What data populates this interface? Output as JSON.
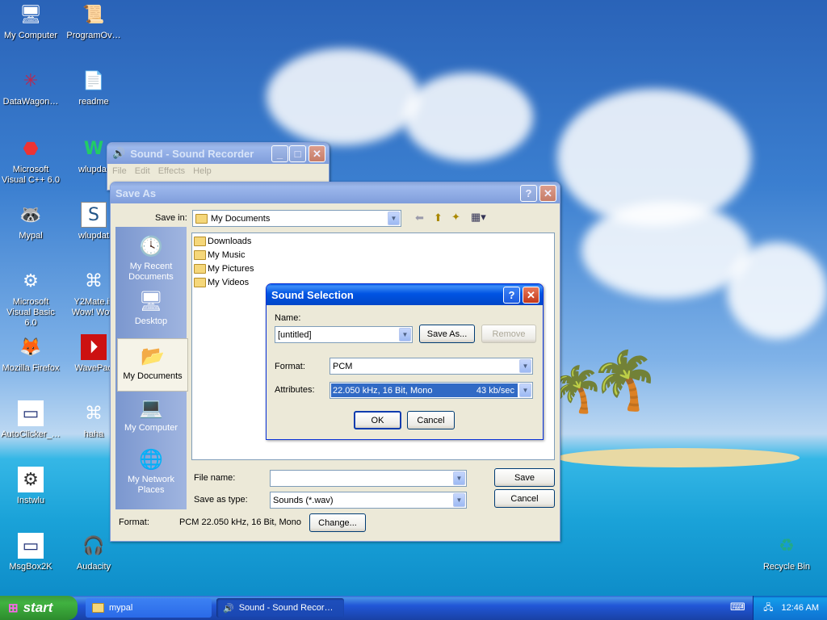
{
  "desktop": {
    "icons": [
      {
        "label": "My Computer",
        "glyph": "🖥"
      },
      {
        "label": "ProgramOv…",
        "glyph": "📜"
      },
      {
        "label": "DataWagon…",
        "glyph": "✳"
      },
      {
        "label": "readme",
        "glyph": "📄"
      },
      {
        "label": "Microsoft Visual C++ 6.0",
        "glyph": "⬣"
      },
      {
        "label": "wlupdat",
        "glyph": "W"
      },
      {
        "label": "Mypal",
        "glyph": "🦝"
      },
      {
        "label": "wlupdat",
        "glyph": "S"
      },
      {
        "label": "Microsoft Visual Basic 6.0",
        "glyph": "⚙"
      },
      {
        "label": "Y2Mate.is Wow! Wow",
        "glyph": "⌘"
      },
      {
        "label": "Mozilla Firefox",
        "glyph": "🦊"
      },
      {
        "label": "WavePad",
        "glyph": "⏵"
      },
      {
        "label": "AutoClicker_…",
        "glyph": "▭"
      },
      {
        "label": "haha",
        "glyph": "⌘"
      },
      {
        "label": "Instwlu",
        "glyph": "⚙"
      },
      {
        "label": "MsgBox2K",
        "glyph": "▭"
      },
      {
        "label": "Audacity",
        "glyph": "🎧"
      },
      {
        "label": "Recycle Bin",
        "glyph": "♻"
      }
    ]
  },
  "recorder": {
    "title": "Sound - Sound Recorder",
    "menu": [
      "File",
      "Edit",
      "Effects",
      "Help"
    ]
  },
  "save_as": {
    "title": "Save As",
    "save_in_label": "Save in:",
    "save_in_value": "My Documents",
    "places": [
      {
        "label": "My Recent Documents",
        "glyph": "🕓"
      },
      {
        "label": "Desktop",
        "glyph": "🖥"
      },
      {
        "label": "My Documents",
        "glyph": "📂"
      },
      {
        "label": "My Computer",
        "glyph": "💻"
      },
      {
        "label": "My Network Places",
        "glyph": "🌐"
      }
    ],
    "files": [
      "Downloads",
      "My Music",
      "My Pictures",
      "My Videos"
    ],
    "file_name_label": "File name:",
    "file_name_value": "",
    "save_type_label": "Save as type:",
    "save_type_value": "Sounds (*.wav)",
    "format_label": "Format:",
    "format_value": "PCM 22.050 kHz, 16 Bit, Mono",
    "save_btn": "Save",
    "cancel_btn": "Cancel",
    "change_btn": "Change..."
  },
  "sound_selection": {
    "title": "Sound Selection",
    "name_label": "Name:",
    "name_value": "[untitled]",
    "save_as_btn": "Save As...",
    "remove_btn": "Remove",
    "format_label": "Format:",
    "format_value": "PCM",
    "attributes_label": "Attributes:",
    "attributes_value": "22.050 kHz, 16 Bit, Mono",
    "attributes_rate": "43 kb/sec",
    "ok_btn": "OK",
    "cancel_btn": "Cancel"
  },
  "taskbar": {
    "start": "start",
    "tasks": [
      "mypal",
      "Sound - Sound Recor…"
    ],
    "clock": "12:46 AM"
  },
  "colors": {
    "accent": "#0054e3",
    "selection": "#316ac5",
    "start_green": "#3c9a3c"
  }
}
